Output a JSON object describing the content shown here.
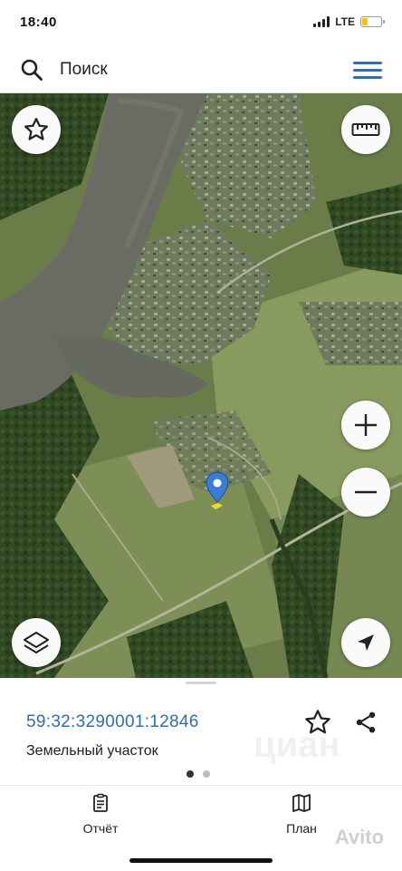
{
  "status_bar": {
    "time": "18:40",
    "network": "LTE",
    "battery_color": "#f2c40f",
    "battery_level_percent": 30
  },
  "search": {
    "placeholder": "Поиск",
    "icon": "search-icon",
    "menu_icon": "hamburger-menu-icon"
  },
  "map": {
    "type": "satellite",
    "controls": {
      "favorite": "star-icon",
      "ruler": "ruler-icon",
      "zoom_in": "plus-icon",
      "zoom_out": "minus-icon",
      "layers": "layers-icon",
      "locate": "navigation-arrow-icon"
    },
    "marker_color": "#3a7bd5"
  },
  "parcel": {
    "cadastral_number": "59:32:3290001:12846",
    "type": "Земельный участок",
    "page_indicator": {
      "pages": 2,
      "active": 1
    },
    "watermark": "циан"
  },
  "tabs": [
    {
      "label": "Отчёт",
      "icon": "report-icon"
    },
    {
      "label": "План",
      "icon": "map-plan-icon"
    }
  ],
  "watermark_avito": "Avito",
  "colors": {
    "accent": "#2f6db2",
    "icon_dark": "#222222"
  }
}
